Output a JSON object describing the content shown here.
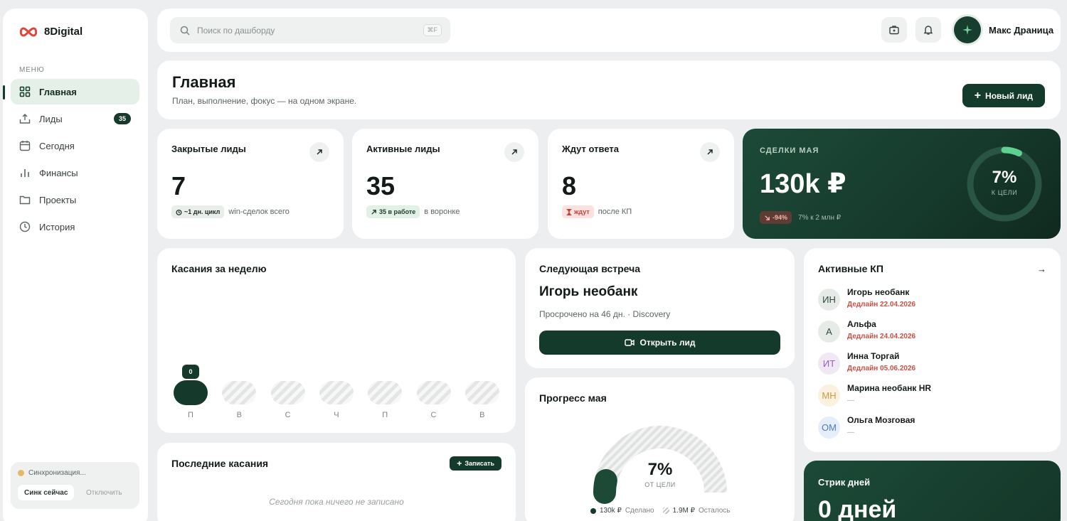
{
  "brand": {
    "name": "8Digital",
    "accent": "#143a2c",
    "logo_color": "#e0453a"
  },
  "sidebar": {
    "menu_label": "МЕНЮ",
    "items": [
      {
        "label": "Главная",
        "icon": "grid-icon",
        "active": true
      },
      {
        "label": "Лиды",
        "icon": "inbox-upload-icon",
        "badge": "35"
      },
      {
        "label": "Сегодня",
        "icon": "calendar-icon"
      },
      {
        "label": "Финансы",
        "icon": "bar-chart-icon"
      },
      {
        "label": "Проекты",
        "icon": "folder-icon"
      },
      {
        "label": "История",
        "icon": "clock-icon"
      }
    ],
    "sync": {
      "status": "Синхронизация...",
      "sync_now": "Синк сейчас",
      "disable": "Отключить"
    }
  },
  "topbar": {
    "search_placeholder": "Поиск по дашборду",
    "shortcut": "⌘F",
    "user_name": "Макс Драница"
  },
  "header": {
    "title": "Главная",
    "subtitle": "План, выполнение, фокус — на одном экране.",
    "new_lead": "Новый лид"
  },
  "stats": [
    {
      "title": "Закрытые лиды",
      "value": "7",
      "pill": "~1 дн. цикл",
      "note": "win-сделок всего"
    },
    {
      "title": "Активные лиды",
      "value": "35",
      "pill": "35 в работе",
      "note": "в воронке"
    },
    {
      "title": "Ждут ответа",
      "value": "8",
      "pill": "ждут",
      "note": "после КП"
    }
  ],
  "deals": {
    "label": "СДЕЛКИ МАЯ",
    "value": "130k ₽",
    "change": "-94%",
    "note": "7% к 2 млн ₽",
    "ring_pct": "7%",
    "ring_label": "К ЦЕЛИ",
    "progress": 0.07
  },
  "week": {
    "title": "Касания за неделю",
    "days": [
      "П",
      "В",
      "С",
      "Ч",
      "П",
      "С",
      "В"
    ],
    "values": [
      0,
      0,
      0,
      0,
      0,
      0,
      0
    ],
    "highlight_label": "0"
  },
  "recent": {
    "title": "Последние касания",
    "record": "Записать",
    "empty": "Сегодня пока ничего не записано"
  },
  "meeting": {
    "title": "Следующая встреча",
    "name": "Игорь необанк",
    "sub": "Просрочено на 46 дн. · Discovery",
    "button": "Открыть лид"
  },
  "progress": {
    "title": "Прогресс мая",
    "pct": "7%",
    "label": "ОТ ЦЕЛИ",
    "done_value": "130k ₽",
    "done_label": "Сделано",
    "left_value": "1.9M ₽",
    "left_label": "Осталось",
    "fraction": 0.07
  },
  "kp": {
    "title": "Активные КП",
    "items": [
      {
        "initials": "ИН",
        "name": "Игорь необанк",
        "deadline": "Дедлайн 22.04.2026",
        "bg": "#e6ebe8",
        "fg": "#2f4a3c"
      },
      {
        "initials": "А",
        "name": "Альфа",
        "deadline": "Дедлайн 24.04.2026",
        "bg": "#e6ebe8",
        "fg": "#2f4a3c"
      },
      {
        "initials": "ИТ",
        "name": "Инна Торгай",
        "deadline": "Дедлайн 05.06.2026",
        "bg": "#f1e8f5",
        "fg": "#9a5fb8"
      },
      {
        "initials": "МН",
        "name": "Марина необанк HR",
        "deadline": "—",
        "bg": "#fbf1e0",
        "fg": "#c99a3e"
      },
      {
        "initials": "ОМ",
        "name": "Ольга Мозговая",
        "deadline": "—",
        "bg": "#e5eefa",
        "fg": "#4f7cc0"
      }
    ]
  },
  "streak": {
    "title": "Стрик дней",
    "value": "0 дней"
  }
}
